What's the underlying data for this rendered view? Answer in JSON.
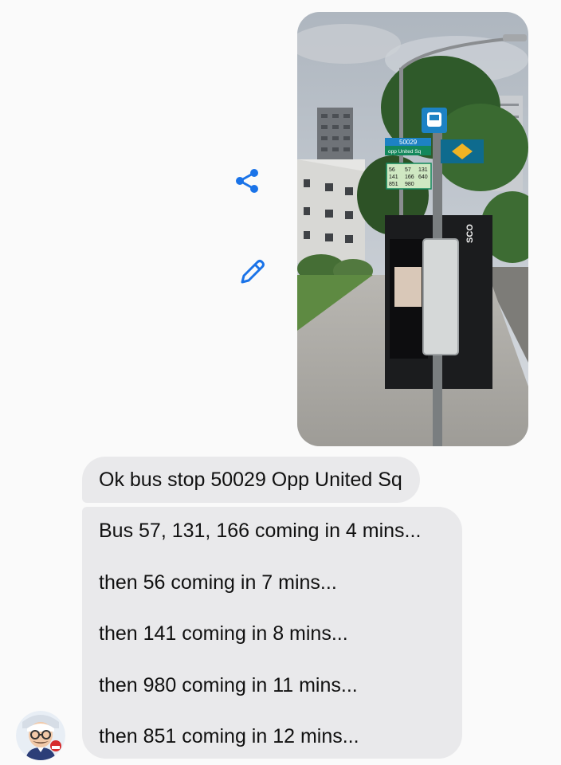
{
  "conversation": {
    "messages": [
      {
        "text": "Ok bus stop 50029 Opp United Sq"
      },
      {
        "lines": [
          "Bus 57, 131, 166 coming in 4 mins...",
          "then 56 coming in 7 mins...",
          "then 141 coming in 8 mins...",
          "then 980 coming in 11 mins...",
          "then 851 coming in 12 mins..."
        ]
      }
    ]
  },
  "photo": {
    "stop_code": "50029",
    "stop_name": "opp United Sq",
    "services": [
      "56",
      "57",
      "131",
      "141",
      "166",
      "640",
      "851",
      "980"
    ],
    "ad_text": "SCO"
  },
  "icons": {
    "share": "share-icon",
    "edit": "pencil-icon",
    "avatar": "bot-avatar"
  },
  "colors": {
    "background": "#fafafa",
    "bubble": "#e9e9eb",
    "text": "#111111",
    "icon_accent": "#1a73e8"
  }
}
